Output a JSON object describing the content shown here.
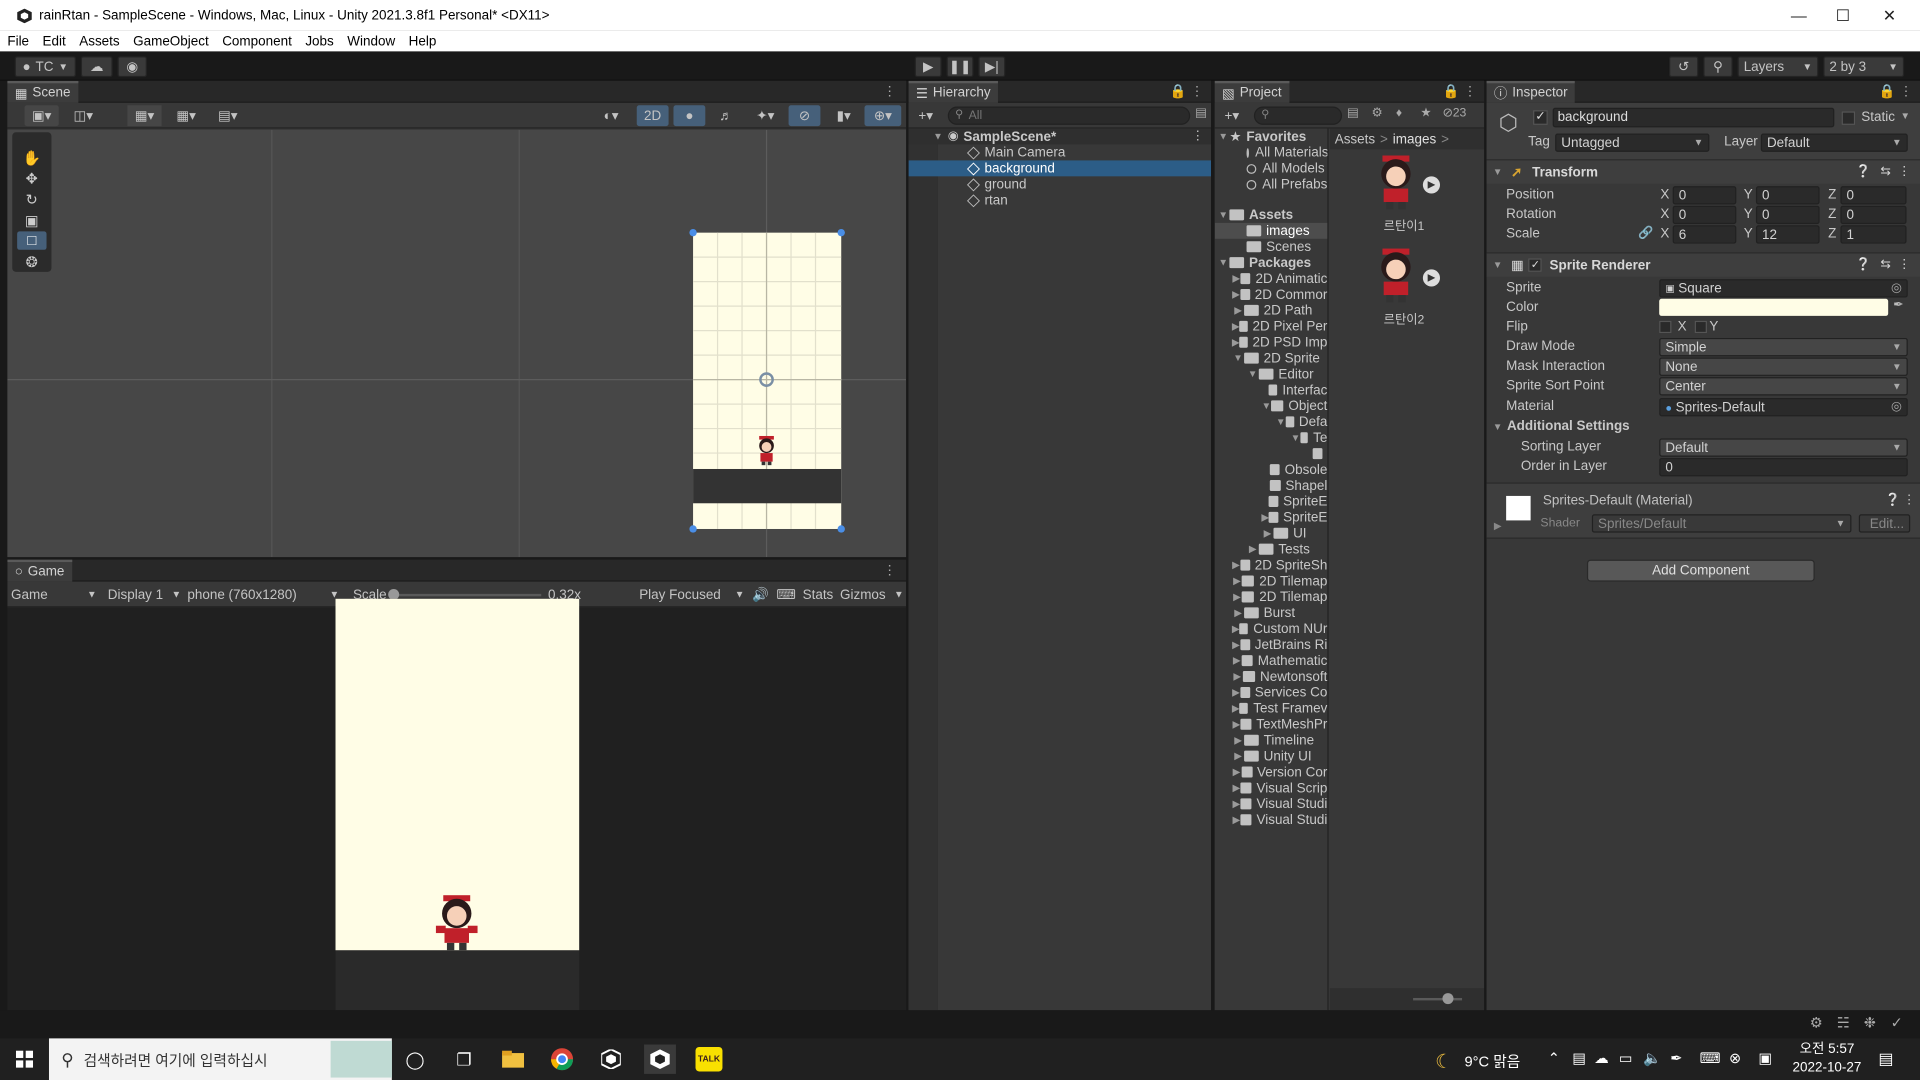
{
  "window": {
    "title": "rainRtan - SampleScene - Windows, Mac, Linux - Unity 2021.3.8f1 Personal* <DX11>"
  },
  "menu": [
    "File",
    "Edit",
    "Assets",
    "GameObject",
    "Component",
    "Jobs",
    "Window",
    "Help"
  ],
  "toolbar": {
    "account": "TC",
    "layers": "Layers",
    "layout": "2 by 3"
  },
  "scene": {
    "tab": "Scene",
    "mode_2d": "2D"
  },
  "game": {
    "tab": "Game",
    "view": "Game",
    "display": "Display 1",
    "resolution": "phone (760x1280)",
    "scale_label": "Scale",
    "scale_value": "0.32x",
    "play_mode": "Play Focused",
    "stats": "Stats",
    "gizmos": "Gizmos"
  },
  "hierarchy": {
    "tab": "Hierarchy",
    "search_placeholder": "All",
    "scene_name": "SampleScene*",
    "items": [
      "Main Camera",
      "background",
      "ground",
      "rtan"
    ]
  },
  "project": {
    "tab": "Project",
    "badge": "23",
    "breadcrumb": [
      "Assets",
      "images"
    ],
    "favorites_label": "Favorites",
    "favorites": [
      "All Materials",
      "All Models",
      "All Prefabs"
    ],
    "assets_label": "Assets",
    "assets": [
      "images",
      "Scenes"
    ],
    "packages_label": "Packages",
    "tree": [
      "2D Animatic",
      "2D Commor",
      "2D Path",
      "2D Pixel Per",
      "2D PSD Imp",
      "2D Sprite",
      "Editor",
      "Interfac",
      "Object",
      "Defa",
      "Te",
      "",
      "Obsole",
      "Shapel",
      "SpriteE",
      "SpriteE",
      "UI",
      "Tests",
      "2D SpriteSh",
      "2D Tilemap",
      "2D Tilemap",
      "Burst",
      "Custom NUr",
      "JetBrains Ri",
      "Mathematic",
      "Newtonsoft",
      "Services Co",
      "Test Framev",
      "TextMeshPr",
      "Timeline",
      "Unity UI",
      "Version Cor",
      "Visual Scrip",
      "Visual Studi",
      "Visual Studi"
    ],
    "thumbnails": [
      "르탄이1",
      "르탄이2"
    ]
  },
  "inspector": {
    "tab": "Inspector",
    "object_name": "background",
    "static_label": "Static",
    "tag_label": "Tag",
    "tag_value": "Untagged",
    "layer_label": "Layer",
    "layer_value": "Default",
    "transform": {
      "title": "Transform",
      "position_label": "Position",
      "position": [
        "0",
        "0",
        "0"
      ],
      "rotation_label": "Rotation",
      "rotation": [
        "0",
        "0",
        "0"
      ],
      "scale_label": "Scale",
      "scale": [
        "6",
        "12",
        "1"
      ]
    },
    "sprite_renderer": {
      "title": "Sprite Renderer",
      "sprite_label": "Sprite",
      "sprite_value": "Square",
      "color_label": "Color",
      "color_value": "#fffde6",
      "flip_label": "Flip",
      "flip_x": "X",
      "flip_y": "Y",
      "draw_mode_label": "Draw Mode",
      "draw_mode_value": "Simple",
      "mask_label": "Mask Interaction",
      "mask_value": "None",
      "sort_point_label": "Sprite Sort Point",
      "sort_point_value": "Center",
      "material_label": "Material",
      "material_value": "Sprites-Default",
      "additional_label": "Additional Settings",
      "sorting_layer_label": "Sorting Layer",
      "sorting_layer_value": "Default",
      "order_label": "Order in Layer",
      "order_value": "0"
    },
    "material": {
      "title": "Sprites-Default (Material)",
      "shader_label": "Shader",
      "shader_value": "Sprites/Default",
      "edit_label": "Edit..."
    },
    "add_component": "Add Component"
  },
  "taskbar": {
    "search_placeholder": "검색하려면 여기에 입력하십시",
    "weather": "9°C 맑음",
    "time": "오전 5:57",
    "date": "2022-10-27",
    "kakao": "TALK"
  },
  "colors": {
    "selection": "#2c5d87",
    "sprite_bg": "#fffde6",
    "panel": "#383838"
  }
}
